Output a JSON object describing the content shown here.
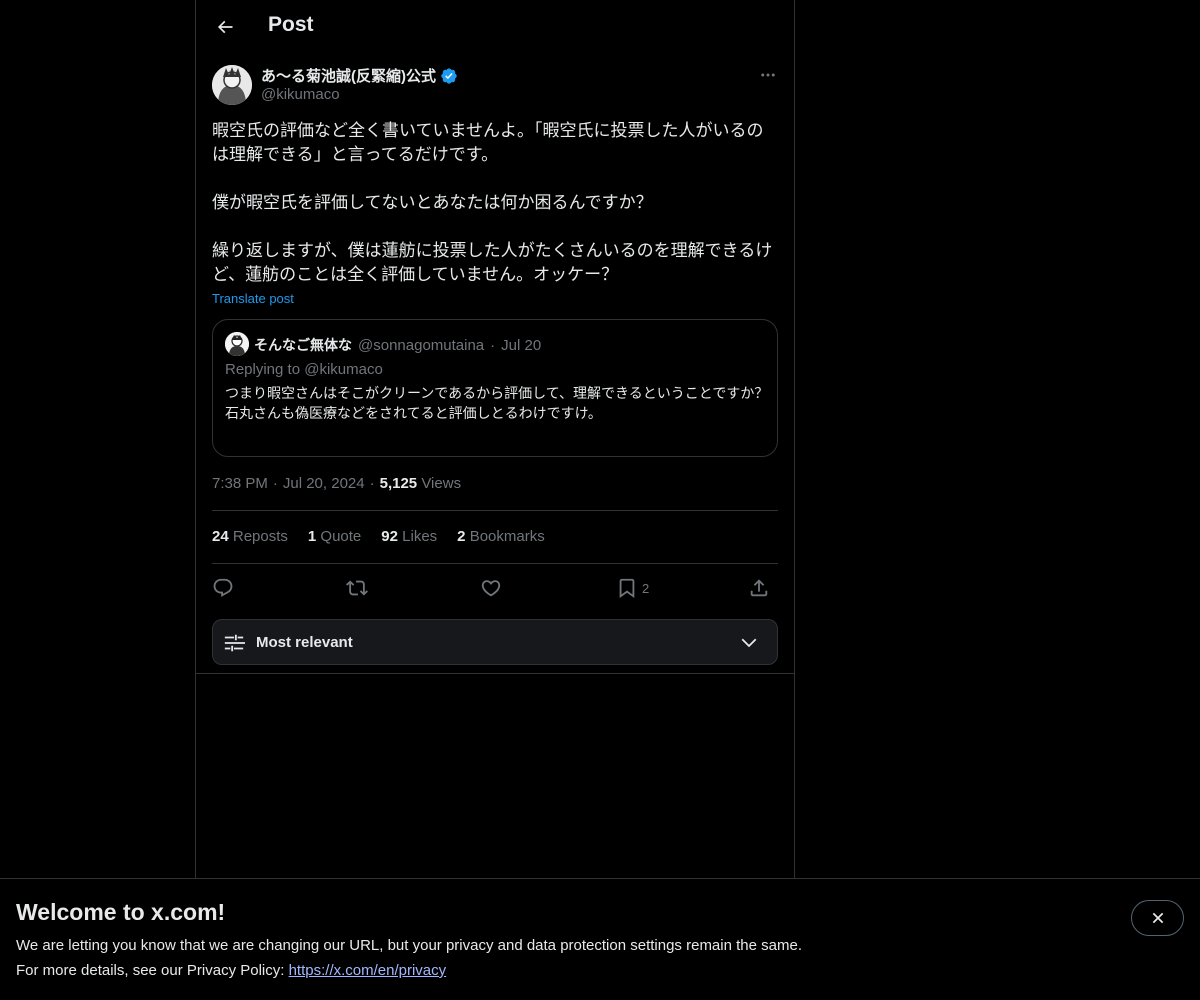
{
  "header": {
    "title": "Post",
    "back_icon": "arrow-left-icon"
  },
  "author": {
    "name": "あ〜る菊池誠(反緊縮)公式",
    "handle": "@kikumaco",
    "verified": true,
    "verified_color": "#1d9bf0"
  },
  "post": {
    "text": "暇空氏の評価など全く書いていませんよ。「暇空氏に投票した人がいるのは理解できる」と言ってるだけです。\n\n僕が暇空氏を評価してないとあなたは何か困るんですか？\n\n繰り返しますが、僕は蓮舫に投票した人がたくさんいるのを理解できるけど、蓮舫のことは全く評価していません。オッケー？",
    "translate_label": "Translate post"
  },
  "quote": {
    "name": "そんなご無体な",
    "handle": "@sonnagomutaina",
    "dot": "·",
    "date": "Jul 20",
    "replying": "Replying to @kikumaco",
    "text": "つまり暇空さんはそこがクリーンであるから評価して、理解できるということですか？\n石丸さんも偽医療などをされてると評価しとるわけですけ。"
  },
  "meta": {
    "time": "7:38 PM",
    "dot": "·",
    "date": "Jul 20, 2024",
    "views_count": "5,125",
    "views_label": "Views"
  },
  "stats": [
    {
      "count": "24",
      "label": "Reposts"
    },
    {
      "count": "1",
      "label": "Quote"
    },
    {
      "count": "92",
      "label": "Likes"
    },
    {
      "count": "2",
      "label": "Bookmarks"
    }
  ],
  "actions": {
    "reply_icon": "reply-icon",
    "repost_icon": "repost-icon",
    "like_icon": "heart-icon",
    "bookmark_icon": "bookmark-icon",
    "bookmark_count": "2",
    "share_icon": "share-icon"
  },
  "sort": {
    "label": "Most relevant"
  },
  "banner": {
    "title": "Welcome to x.com!",
    "line1": "We are letting you know that we are changing our URL, but your privacy and data protection settings remain the same.",
    "line2_prefix": "For more details, see our Privacy Policy: ",
    "link": "https://x.com/en/privacy"
  },
  "colors": {
    "background": "#000000",
    "border": "#2f3336",
    "muted": "#71767b",
    "accent": "#1d9bf0"
  }
}
